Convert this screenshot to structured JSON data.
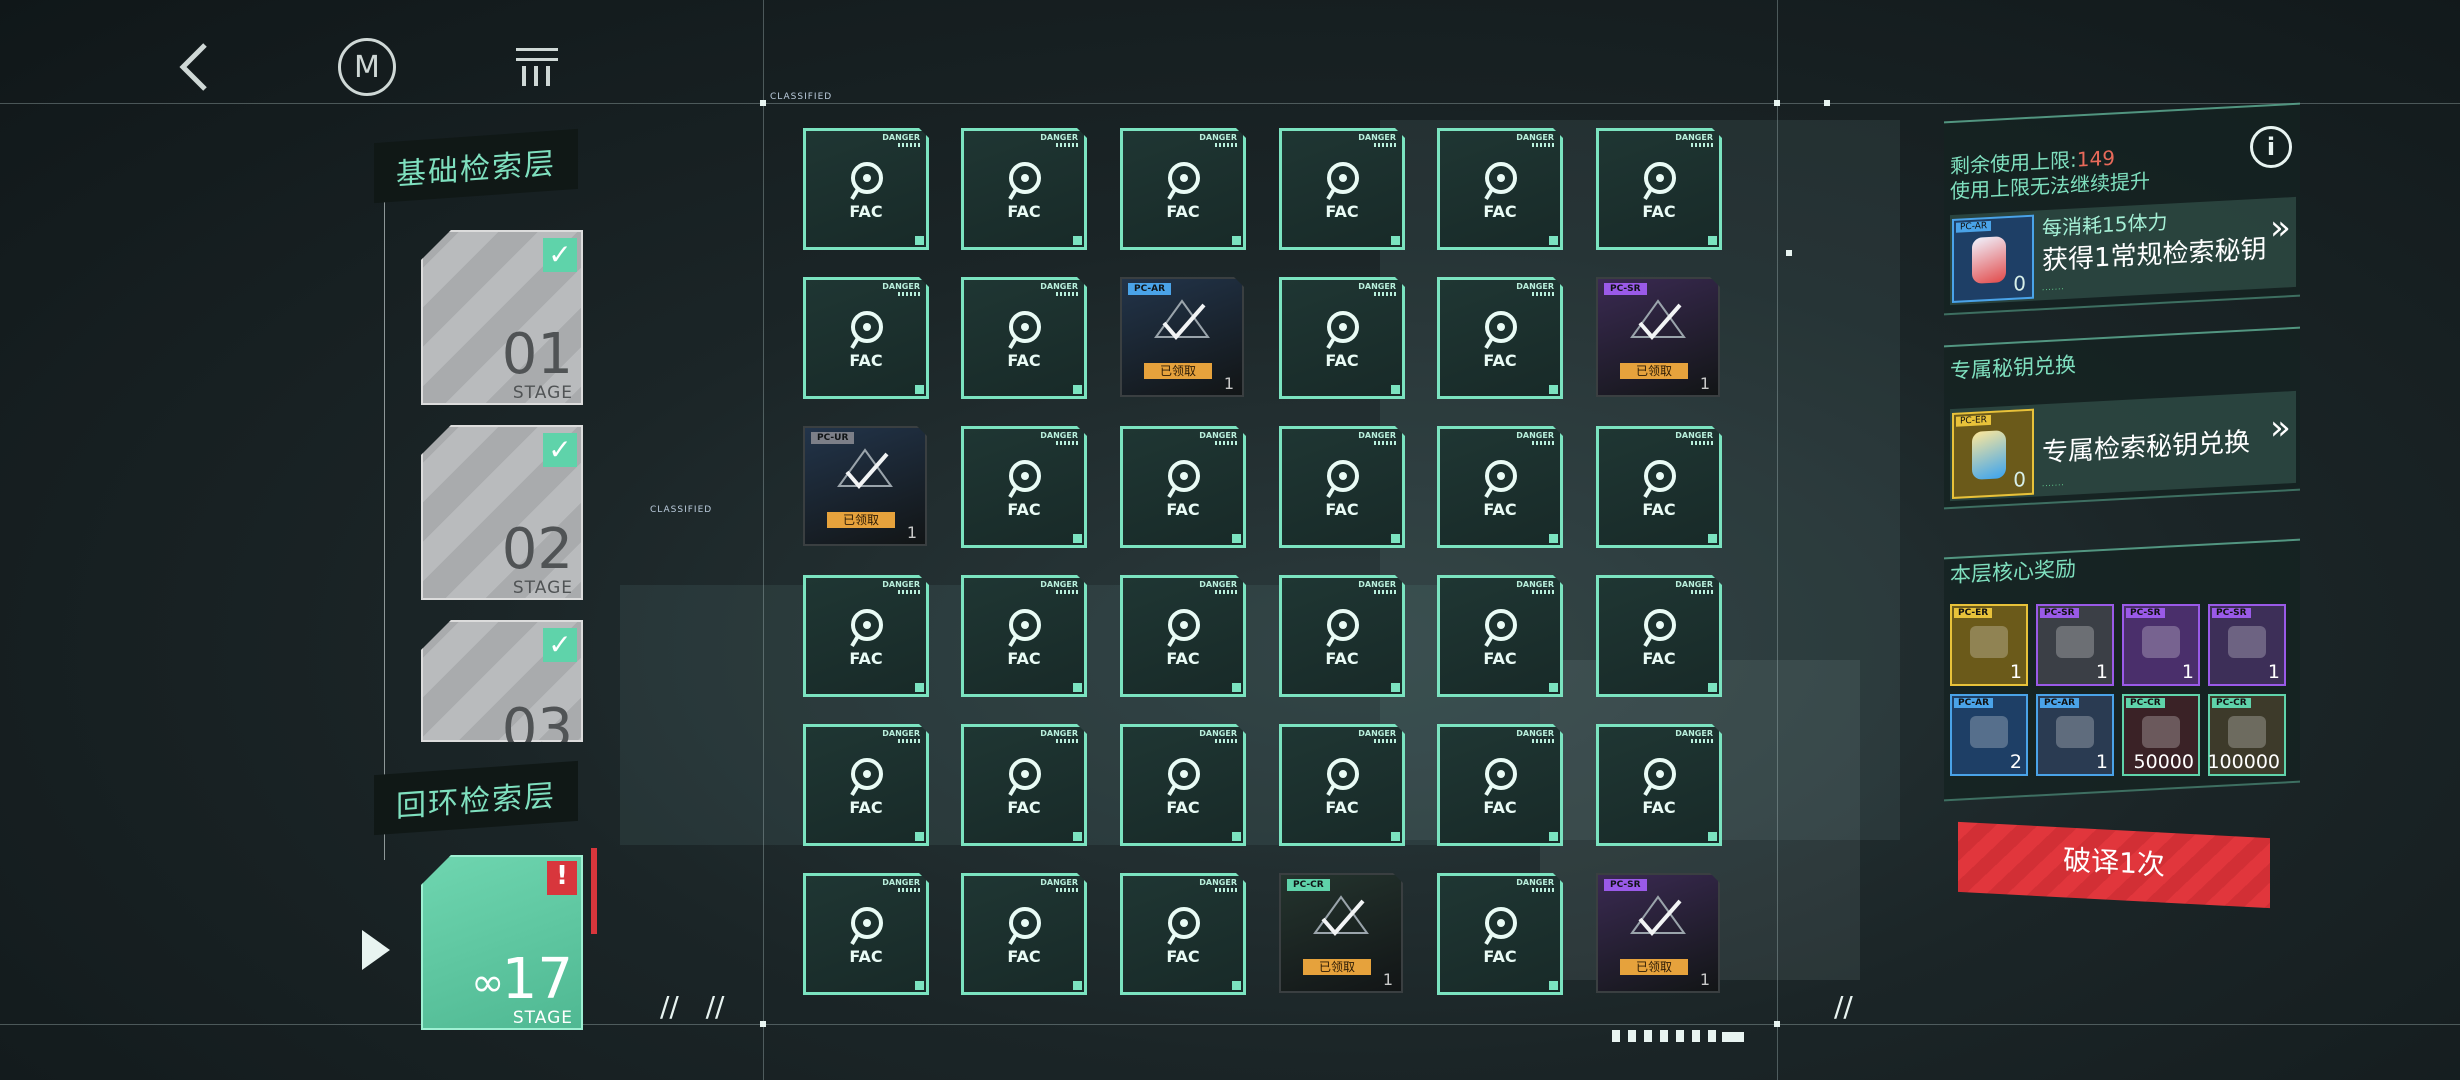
{
  "nav": {
    "back_icon": "back-chevron-icon",
    "logo_letter": "M",
    "menu_icon": "menu-bars-icon"
  },
  "classified_label": "CLASSIFIED",
  "stages": {
    "base_layer_title": "基础检索层",
    "loop_layer_title": "回环检索层",
    "list": [
      {
        "num": "01",
        "sub": "STAGE",
        "completed": true
      },
      {
        "num": "02",
        "sub": "STAGE",
        "completed": true
      },
      {
        "num": "03",
        "sub": "STAGE",
        "completed": true
      }
    ],
    "current": {
      "num": "17",
      "sub": "STAGE",
      "infinity": "∞",
      "alert": "!"
    }
  },
  "grid": {
    "fac_label": "FAC",
    "danger_label": "DANGER",
    "claimed_text": "已领取",
    "cells": [
      {
        "r": 0,
        "c": 0,
        "state": "fac"
      },
      {
        "r": 0,
        "c": 1,
        "state": "fac"
      },
      {
        "r": 0,
        "c": 2,
        "state": "fac"
      },
      {
        "r": 0,
        "c": 3,
        "state": "fac"
      },
      {
        "r": 0,
        "c": 4,
        "state": "fac"
      },
      {
        "r": 0,
        "c": 5,
        "state": "fac"
      },
      {
        "r": 1,
        "c": 0,
        "state": "fac"
      },
      {
        "r": 1,
        "c": 1,
        "state": "fac"
      },
      {
        "r": 1,
        "c": 2,
        "state": "claimed",
        "color": "blue",
        "tag": "PC-AR",
        "tag_color": "#4aa3e8",
        "count": "1"
      },
      {
        "r": 1,
        "c": 3,
        "state": "fac"
      },
      {
        "r": 1,
        "c": 4,
        "state": "fac"
      },
      {
        "r": 1,
        "c": 5,
        "state": "claimed",
        "color": "purple",
        "tag": "PC-SR",
        "tag_color": "#9a5ae8",
        "count": "1"
      },
      {
        "r": 2,
        "c": 0,
        "state": "claimed",
        "color": "blue",
        "tag": "PC-UR",
        "tag_color": "#7c7f88",
        "count": "1"
      },
      {
        "r": 2,
        "c": 1,
        "state": "fac"
      },
      {
        "r": 2,
        "c": 2,
        "state": "fac"
      },
      {
        "r": 2,
        "c": 3,
        "state": "fac"
      },
      {
        "r": 2,
        "c": 4,
        "state": "fac"
      },
      {
        "r": 2,
        "c": 5,
        "state": "fac"
      },
      {
        "r": 3,
        "c": 0,
        "state": "fac"
      },
      {
        "r": 3,
        "c": 1,
        "state": "fac"
      },
      {
        "r": 3,
        "c": 2,
        "state": "fac"
      },
      {
        "r": 3,
        "c": 3,
        "state": "fac"
      },
      {
        "r": 3,
        "c": 4,
        "state": "fac"
      },
      {
        "r": 3,
        "c": 5,
        "state": "fac"
      },
      {
        "r": 4,
        "c": 0,
        "state": "fac"
      },
      {
        "r": 4,
        "c": 1,
        "state": "fac"
      },
      {
        "r": 4,
        "c": 2,
        "state": "fac"
      },
      {
        "r": 4,
        "c": 3,
        "state": "fac"
      },
      {
        "r": 4,
        "c": 4,
        "state": "fac"
      },
      {
        "r": 4,
        "c": 5,
        "state": "fac"
      },
      {
        "r": 5,
        "c": 0,
        "state": "fac"
      },
      {
        "r": 5,
        "c": 1,
        "state": "fac"
      },
      {
        "r": 5,
        "c": 2,
        "state": "fac"
      },
      {
        "r": 5,
        "c": 3,
        "state": "claimed",
        "color": "green",
        "tag": "PC-CR",
        "tag_color": "#5fd3aa",
        "count": "1"
      },
      {
        "r": 5,
        "c": 4,
        "state": "fac"
      },
      {
        "r": 5,
        "c": 5,
        "state": "claimed",
        "color": "purple",
        "tag": "PC-SR",
        "tag_color": "#9a5ae8",
        "count": "1"
      }
    ]
  },
  "right": {
    "limit_prefix": "剩余使用上限:",
    "limit_value": "149",
    "limit_note": "使用上限无法继续提升",
    "info_icon": "i",
    "stamina_card": {
      "title": "每消耗15体力",
      "text": "获得1常规检索秘钥",
      "tag": "PC-AR",
      "count": "0"
    },
    "exchange_title": "专属秘钥兑换",
    "exchange_card": {
      "text": "专属检索秘钥兑换",
      "tag": "PC-ER",
      "count": "0"
    },
    "rewards_title": "本层核心奖励",
    "rewards": [
      {
        "tag": "PC-ER",
        "tag_color": "#e8c23a",
        "bg": "#6b5a1a",
        "count": "1"
      },
      {
        "tag": "PC-SR",
        "tag_color": "#9a5ae8",
        "bg": "#3b3f46",
        "count": "1"
      },
      {
        "tag": "PC-SR",
        "tag_color": "#9a5ae8",
        "bg": "#4a2f6b",
        "count": "1"
      },
      {
        "tag": "PC-SR",
        "tag_color": "#9a5ae8",
        "bg": "#3d2f58",
        "count": "1"
      },
      {
        "tag": "PC-AR",
        "tag_color": "#4aa3e8",
        "bg": "#1e3f66",
        "count": "2"
      },
      {
        "tag": "PC-AR",
        "tag_color": "#4aa3e8",
        "bg": "#2a3b52",
        "count": "1"
      },
      {
        "tag": "PC-CR",
        "tag_color": "#5fd3aa",
        "bg": "#3a2226",
        "count": "50000"
      },
      {
        "tag": "PC-CR",
        "tag_color": "#5fd3aa",
        "bg": "#3d3a2a",
        "count": "100000"
      }
    ],
    "decode_button": "破译1次",
    "forward_icon": "double-chevron-right-icon"
  },
  "colors": {
    "accent": "#7be3c0",
    "danger": "#e1363c",
    "limit": "#e86a5a"
  }
}
